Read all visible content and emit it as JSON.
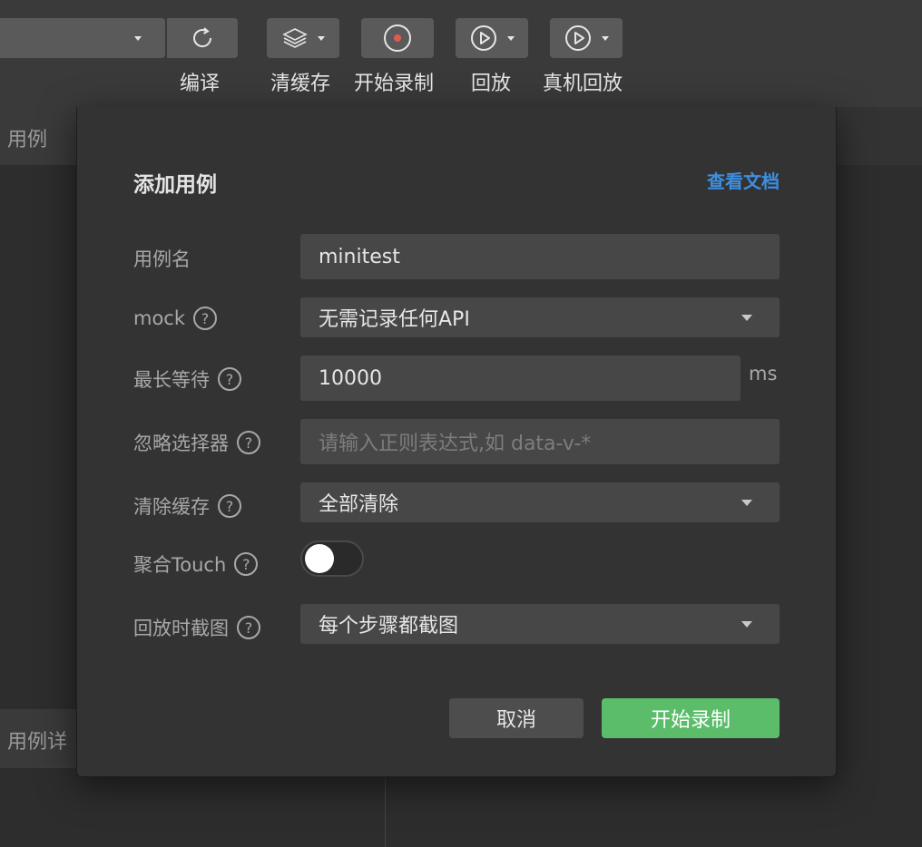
{
  "toolbar": {
    "items": [
      {
        "label": "编译",
        "icon": "refresh-icon"
      },
      {
        "label": "清缓存",
        "icon": "layers-icon"
      },
      {
        "label": "开始录制",
        "icon": "record-icon"
      },
      {
        "label": "回放",
        "icon": "play-icon"
      },
      {
        "label": "真机回放",
        "icon": "play-icon"
      }
    ]
  },
  "background": {
    "top_label": "用例",
    "bottom_label": "用例详"
  },
  "modal": {
    "title": "添加用例",
    "doc_link": "查看文档",
    "fields": {
      "name": {
        "label": "用例名",
        "value": "minitest"
      },
      "mock": {
        "label": "mock",
        "value": "无需记录任何API"
      },
      "wait": {
        "label": "最长等待",
        "value": "10000",
        "unit": "ms"
      },
      "ignore": {
        "label": "忽略选择器",
        "placeholder": "请输入正则表达式,如 data-v-*"
      },
      "clear_cache": {
        "label": "清除缓存",
        "value": "全部清除"
      },
      "touch": {
        "label": "聚合Touch",
        "enabled": false
      },
      "screenshot": {
        "label": "回放时截图",
        "value": "每个步骤都截图"
      }
    },
    "help_symbol": "?",
    "buttons": {
      "cancel": "取消",
      "start": "开始录制"
    }
  },
  "colors": {
    "accent_link": "#3d8fe0",
    "primary_button": "#5bbd6a",
    "record_dot": "#e05a4f"
  }
}
